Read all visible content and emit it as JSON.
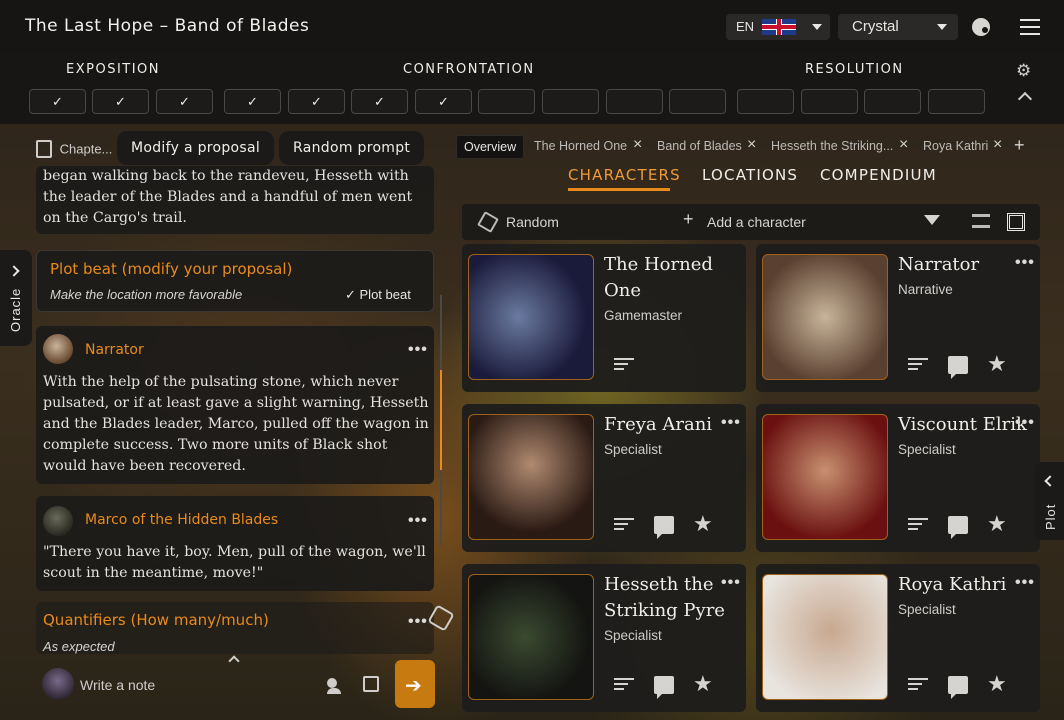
{
  "app": {
    "title": "The Last Hope – Band of Blades",
    "language_code": "EN",
    "theme": "Crystal"
  },
  "acts": [
    {
      "label": "EXPOSITION"
    },
    {
      "label": "CONFRONTATION"
    },
    {
      "label": "RESOLUTION"
    }
  ],
  "beats": [
    "✓",
    "✓",
    "✓",
    "✓",
    "✓",
    "✓",
    "✓",
    "",
    "",
    "",
    "",
    "",
    "",
    "",
    ""
  ],
  "left": {
    "chapter_label": "Chapte...",
    "modify_proposal": "Modify a proposal",
    "random_prompt": "Random prompt",
    "intro_text": "began walking back to the randeveu, Hesseth with the leader of the Blades and a handful of men went on the Cargo's trail.",
    "plot_beat_title": "Plot beat (modify your proposal)",
    "plot_beat_text": "Make the location more favorable",
    "plot_beat_check": "✓ Plot beat",
    "narrator_name": "Narrator",
    "narrator_text": "With the help of the pulsating stone, which never pulsated, or if at least gave a slight warning, Hesseth and the Blades leader, Marco, pulled off the wagon in complete success. Two more units of Black shot would have been recovered.",
    "marco_name": "Marco of the Hidden Blades",
    "marco_text": "\"There you have it, boy. Men, pull of the wagon, we'll scout in the meantime, move!\"",
    "quantifiers_title": "Quantifiers (How many/much)",
    "quantifiers_text": "As expected",
    "note_placeholder": "Write a note",
    "oracle_label": "Oracle"
  },
  "right": {
    "tabs": [
      {
        "label": "Overview"
      },
      {
        "label": "The Horned One"
      },
      {
        "label": "Band of Blades"
      },
      {
        "label": "Hesseth the Striking..."
      },
      {
        "label": "Roya Kathri"
      }
    ],
    "main_tabs": [
      "CHARACTERS",
      "LOCATIONS",
      "COMPENDIUM"
    ],
    "random_label": "Random",
    "add_character": "Add a character",
    "plot_label": "Plot",
    "characters": [
      {
        "name": "The Horned One",
        "role": "Gamemaster"
      },
      {
        "name": "Narrator",
        "role": "Narrative"
      },
      {
        "name": "Freya Arani",
        "role": "Specialist"
      },
      {
        "name": "Viscount Elrik",
        "role": "Specialist"
      },
      {
        "name": "Hesseth the Striking Pyre",
        "role": "Specialist"
      },
      {
        "name": "Roya Kathri",
        "role": "Specialist"
      }
    ]
  },
  "colors": {
    "accent": "#e88a1c",
    "panel": "#1b1a18",
    "topbar": "#161513"
  }
}
